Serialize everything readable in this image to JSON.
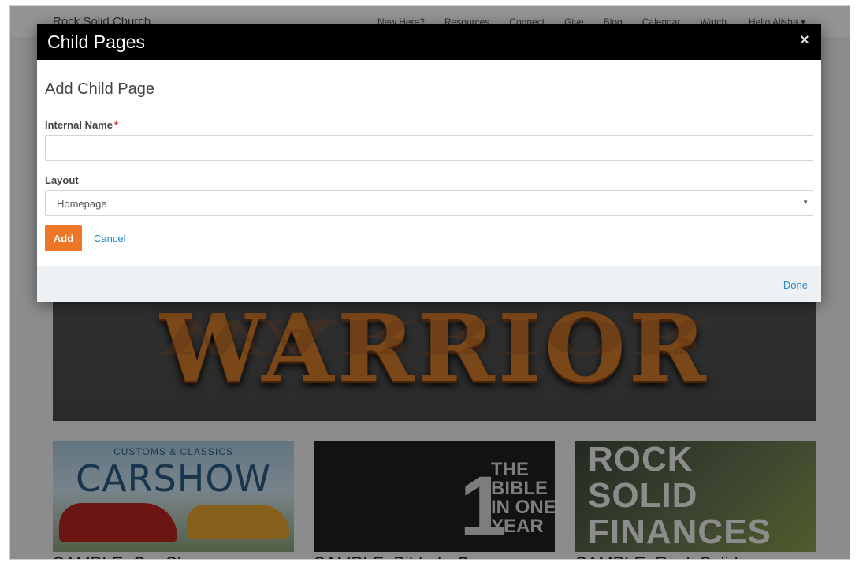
{
  "site": {
    "brand": "Rock Solid Church",
    "nav": [
      "New Here?",
      "Resources",
      "Connect",
      "Give",
      "Blog",
      "Calendar",
      "Watch"
    ],
    "user": "Hello Alisha ▾",
    "hero_word": "WARRIOR",
    "cards": [
      {
        "top": "CUSTOMS & CLASSICS",
        "main": "CARSHOW",
        "caption": "SAMPLE: Car Show"
      },
      {
        "num": "1",
        "text": "THE\nBIBLE\nIN ONE\nYEAR",
        "caption": "SAMPLE: Bible In One"
      },
      {
        "text": "ROCK\nSOLID\nFINANCES",
        "caption": "SAMPLE: Rock Solid"
      }
    ]
  },
  "modal": {
    "title": "Child Pages",
    "close_icon": "×",
    "section_title": "Add Child Page",
    "internal_name": {
      "label": "Internal Name",
      "required_marker": "*",
      "value": ""
    },
    "layout": {
      "label": "Layout",
      "selected": "Homepage",
      "caret": "▼"
    },
    "add_label": "Add",
    "cancel_label": "Cancel",
    "done_label": "Done"
  },
  "colors": {
    "accent": "#ee7624",
    "link": "#2a86c5",
    "header": "#000000",
    "required": "#e4322b"
  }
}
